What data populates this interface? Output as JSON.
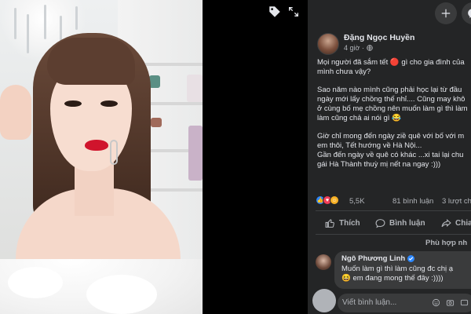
{
  "post": {
    "author": "Đặng Ngọc Huyền",
    "time": "4 giờ ·",
    "lines": [
      "Mọi người đã sắm tết 🔴 gì cho gia đình của",
      "mình chưa vậy?",
      "",
      "Sao năm nào mình cũng phải học lại từ đầu",
      "ngày mới lấy chồng thế nhỉ.... Cũng may khô",
      "ở cùng bố mẹ chồng nên muốn làm gì thì làm",
      "làm cũng chả ai nói gì 😂",
      "",
      "Giờ chỉ mong đến ngày ziề quê với bố với m",
      "em thôi, Tết hướng về Hà Nội...",
      "Gần đến ngày về quê có khác ...xi tai lại chu",
      "gái Hà Thành thuỳ mị nết na ngay :)))"
    ],
    "reactions_count": "5,5K",
    "comments_count": "81 bình luận",
    "shares_count": "3 lượt ch"
  },
  "actions": {
    "like": "Thích",
    "comment": "Bình luận",
    "share": "Chia"
  },
  "comments": {
    "sort_label": "Phù hợp nh",
    "items": [
      {
        "author": "Ngô Phương Linh",
        "line1": "Muốn làm gì thì làm cũng đc chị ạ",
        "line2": "😆 em đang mong thế đây :))))"
      }
    ]
  },
  "composer": {
    "placeholder": "Viết bình luận..."
  },
  "colors": {
    "panel_bg": "#242526",
    "bubble_bg": "#3a3b3c",
    "like_blue": "#2d88ff",
    "love_red": "#f33e58",
    "haha_yellow": "#f7b125"
  },
  "icons": [
    "tag-icon",
    "expand-icon",
    "plus-icon",
    "messenger-icon",
    "globe-icon",
    "like-icon",
    "comment-icon",
    "share-icon",
    "verified-icon",
    "emoji-icon",
    "camera-icon",
    "gif-icon"
  ]
}
